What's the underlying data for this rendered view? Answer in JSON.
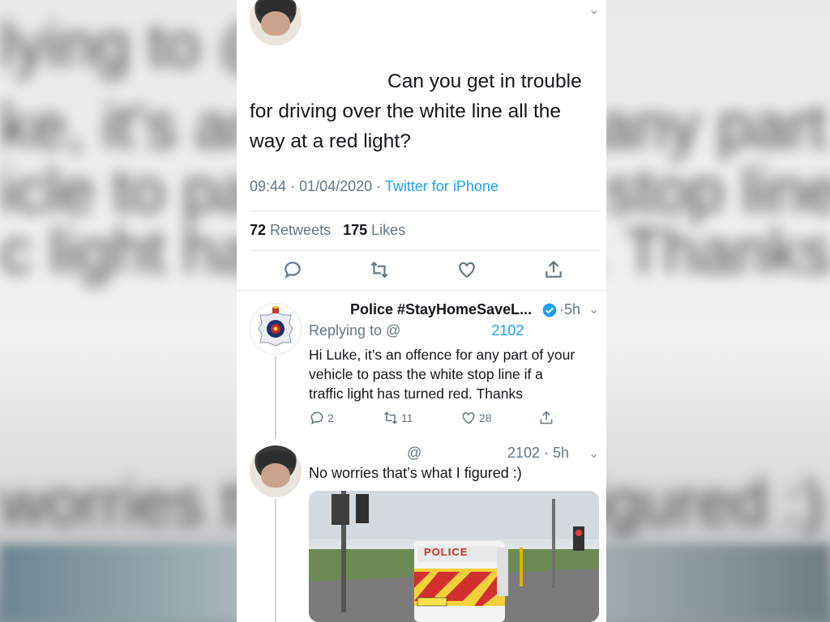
{
  "tweet": {
    "text_line1": "Can you get in trouble",
    "text_line2": "for driving over the white line all the",
    "text_line3": "way at a red light?",
    "time": "09:44",
    "date": "01/04/2020",
    "client": "Twitter for iPhone",
    "retweets_count": "72",
    "retweets_label": "Retweets",
    "likes_count": "175",
    "likes_label": "Likes"
  },
  "reply1": {
    "name": "Police #StayHomeSaveL...",
    "verified": true,
    "age": "5h",
    "replying_prefix": "Replying to @",
    "replying_suffix": "2102",
    "body_line1": "Hi Luke, it’s an offence for any part of your",
    "body_line2": "vehicle to pass the white stop line if a",
    "body_line3": "traffic light has turned red. Thanks",
    "replies": "2",
    "retweets": "11",
    "likes": "28"
  },
  "reply2": {
    "at": "@",
    "handle_suffix": "2102",
    "age": "5h",
    "body": "No worries that’s what I figured :)",
    "photo_van_text": "POLICE"
  },
  "colors": {
    "accent": "#1da1f2",
    "muted": "#657786",
    "text": "#14171a"
  },
  "background": {
    "line1": "lying to @",
    "line2": "ke, it's an offence for any part of your",
    "line3": "icle to pass the white stop line if a",
    "line4": "c light has turned red. Thanks",
    "line5": "worries that's what I figured :)"
  }
}
